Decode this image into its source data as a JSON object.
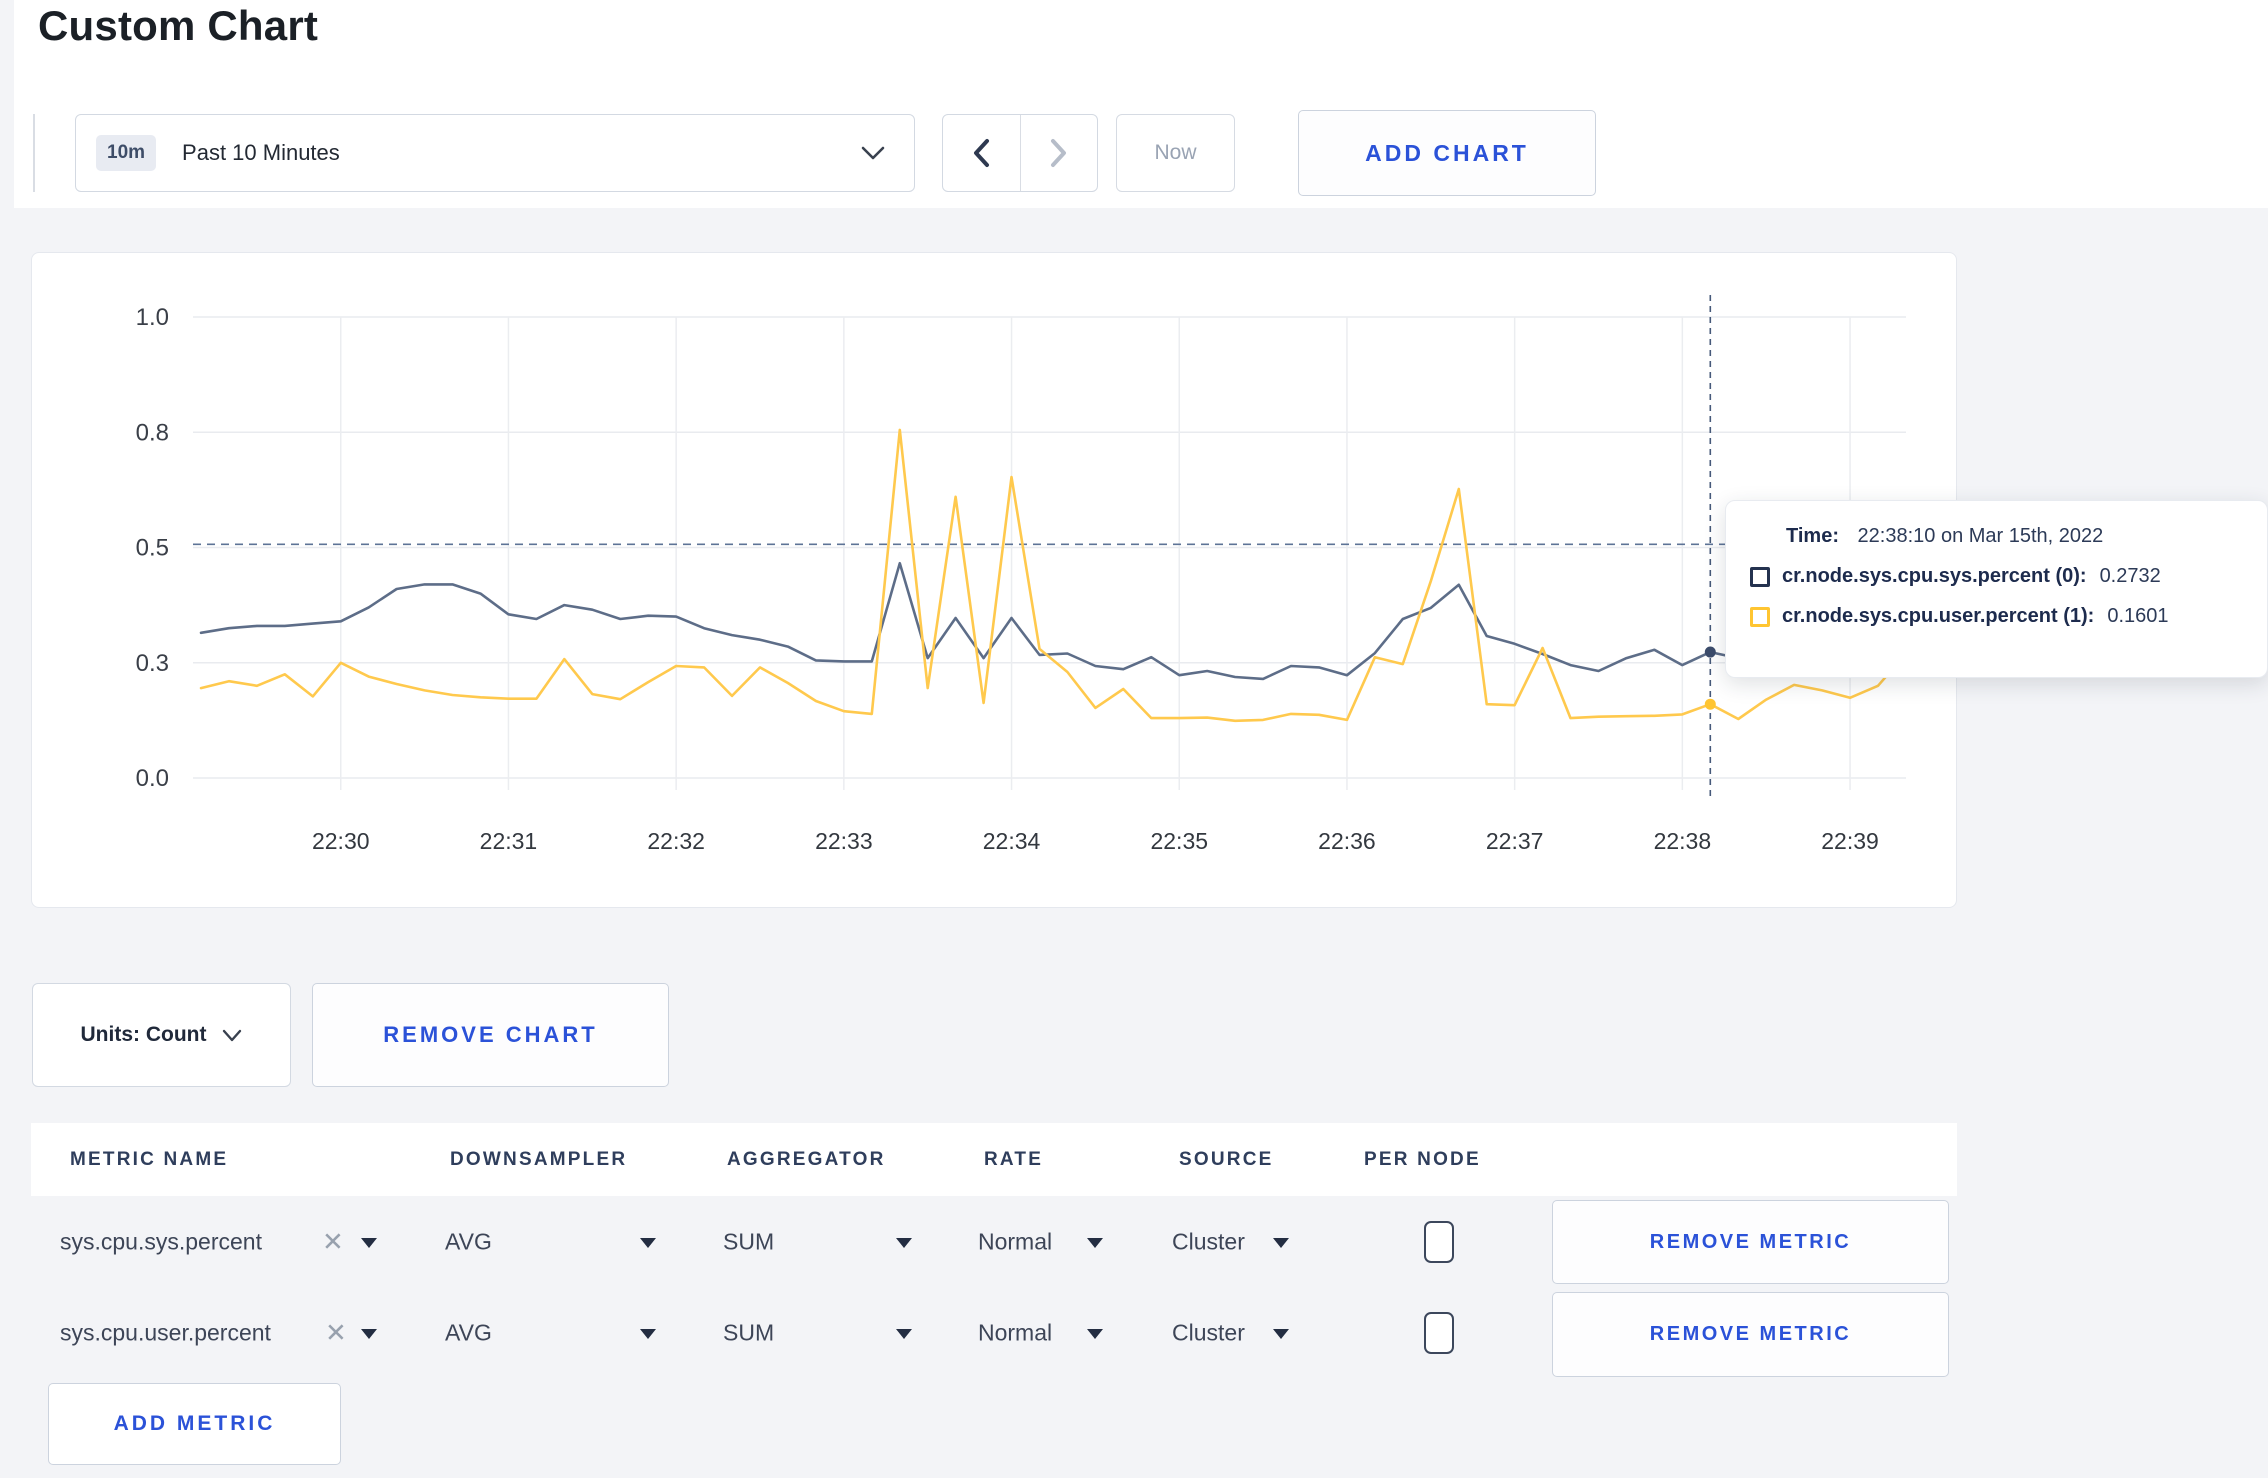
{
  "page_title": "Custom Chart",
  "toolbar": {
    "time_badge": "10m",
    "time_range_label": "Past 10 Minutes",
    "now_label": "Now",
    "add_chart_label": "ADD CHART"
  },
  "chart": {
    "tooltip": {
      "time_label": "Time:",
      "time_value": "22:38:10 on Mar 15th, 2022",
      "series": [
        {
          "swatch": "#24324f",
          "label": "cr.node.sys.cpu.sys.percent (0):",
          "value": "0.2732"
        },
        {
          "swatch": "#ffc531",
          "label": "cr.node.sys.cpu.user.percent (1):",
          "value": "0.1601"
        }
      ]
    }
  },
  "chart_data": {
    "type": "line",
    "title": "Custom Chart time series",
    "x_times": [
      "22:29:10",
      "22:29:20",
      "22:29:30",
      "22:29:40",
      "22:29:50",
      "22:30:00",
      "22:30:10",
      "22:30:20",
      "22:30:30",
      "22:30:40",
      "22:30:50",
      "22:31:00",
      "22:31:10",
      "22:31:20",
      "22:31:30",
      "22:31:40",
      "22:31:50",
      "22:32:00",
      "22:32:10",
      "22:32:20",
      "22:32:30",
      "22:32:40",
      "22:32:50",
      "22:33:00",
      "22:33:10",
      "22:33:20",
      "22:33:30",
      "22:33:40",
      "22:33:50",
      "22:34:00",
      "22:34:10",
      "22:34:20",
      "22:34:30",
      "22:34:40",
      "22:34:50",
      "22:35:00",
      "22:35:10",
      "22:35:20",
      "22:35:30",
      "22:35:40",
      "22:35:50",
      "22:36:00",
      "22:36:10",
      "22:36:20",
      "22:36:30",
      "22:36:40",
      "22:36:50",
      "22:37:00",
      "22:37:10",
      "22:37:20",
      "22:37:30",
      "22:37:40",
      "22:37:50",
      "22:38:00",
      "22:38:10",
      "22:38:20",
      "22:38:30",
      "22:38:40",
      "22:38:50",
      "22:39:00",
      "22:39:10",
      "22:39:20"
    ],
    "series": [
      {
        "name": "cr.node.sys.cpu.sys.percent",
        "color": "#5d6d88",
        "values": [
          0.315,
          0.325,
          0.33,
          0.33,
          0.335,
          0.34,
          0.37,
          0.41,
          0.42,
          0.42,
          0.4,
          0.355,
          0.345,
          0.375,
          0.365,
          0.345,
          0.352,
          0.35,
          0.325,
          0.31,
          0.3,
          0.285,
          0.255,
          0.253,
          0.253,
          0.466,
          0.26,
          0.347,
          0.26,
          0.347,
          0.267,
          0.27,
          0.243,
          0.236,
          0.262,
          0.223,
          0.232,
          0.219,
          0.215,
          0.243,
          0.24,
          0.223,
          0.271,
          0.345,
          0.369,
          0.419,
          0.308,
          0.291,
          0.269,
          0.245,
          0.232,
          0.26,
          0.278,
          0.245,
          0.2732,
          0.26,
          0.27,
          0.28,
          0.29,
          0.3,
          0.3,
          0.31
        ]
      },
      {
        "name": "cr.node.sys.cpu.user.percent",
        "color": "#ffc94d",
        "values": [
          0.195,
          0.21,
          0.2,
          0.225,
          0.177,
          0.25,
          0.22,
          0.204,
          0.19,
          0.18,
          0.175,
          0.172,
          0.172,
          0.258,
          0.182,
          0.171,
          0.208,
          0.243,
          0.24,
          0.178,
          0.24,
          0.206,
          0.167,
          0.145,
          0.139,
          0.755,
          0.195,
          0.61,
          0.163,
          0.653,
          0.28,
          0.23,
          0.152,
          0.193,
          0.13,
          0.13,
          0.131,
          0.124,
          0.126,
          0.139,
          0.137,
          0.126,
          0.262,
          0.247,
          0.427,
          0.627,
          0.16,
          0.158,
          0.282,
          0.13,
          0.133,
          0.134,
          0.135,
          0.138,
          0.1601,
          0.128,
          0.17,
          0.202,
          0.19,
          0.174,
          0.2,
          0.27
        ]
      }
    ],
    "ylim": [
      0,
      1
    ],
    "y_ticks": [
      0,
      0.25,
      0.5,
      0.75,
      1
    ],
    "y_tick_labels": [
      "0.0",
      "0.3",
      "0.5",
      "0.8",
      "1.0"
    ],
    "x_tick_labels": [
      "22:30",
      "22:31",
      "22:32",
      "22:33",
      "22:34",
      "22:35",
      "22:36",
      "22:37",
      "22:38",
      "22:39"
    ],
    "x_tick_indices": [
      5,
      11,
      17,
      23,
      29,
      35,
      41,
      47,
      53,
      59
    ],
    "grid": true,
    "legend_position": "none",
    "threshold_y": 0.507,
    "crosshair_index": 54,
    "crosshair": {
      "time": "22:38:10 on Mar 15th, 2022",
      "values": {
        "cr.node.sys.cpu.sys.percent": 0.2732,
        "cr.node.sys.cpu.user.percent": 0.1601
      }
    }
  },
  "controls": {
    "units_label": "Units: Count",
    "remove_chart_label": "REMOVE CHART",
    "add_metric_label": "ADD METRIC"
  },
  "metrics_table": {
    "headers": [
      "METRIC NAME",
      "DOWNSAMPLER",
      "AGGREGATOR",
      "RATE",
      "SOURCE",
      "PER NODE"
    ],
    "rows": [
      {
        "metric": "sys.cpu.sys.percent",
        "downsampler": "AVG",
        "aggregator": "SUM",
        "rate": "Normal",
        "source": "Cluster",
        "per_node": false,
        "remove_label": "REMOVE METRIC"
      },
      {
        "metric": "sys.cpu.user.percent",
        "downsampler": "AVG",
        "aggregator": "SUM",
        "rate": "Normal",
        "source": "Cluster",
        "per_node": false,
        "remove_label": "REMOVE METRIC"
      }
    ]
  }
}
